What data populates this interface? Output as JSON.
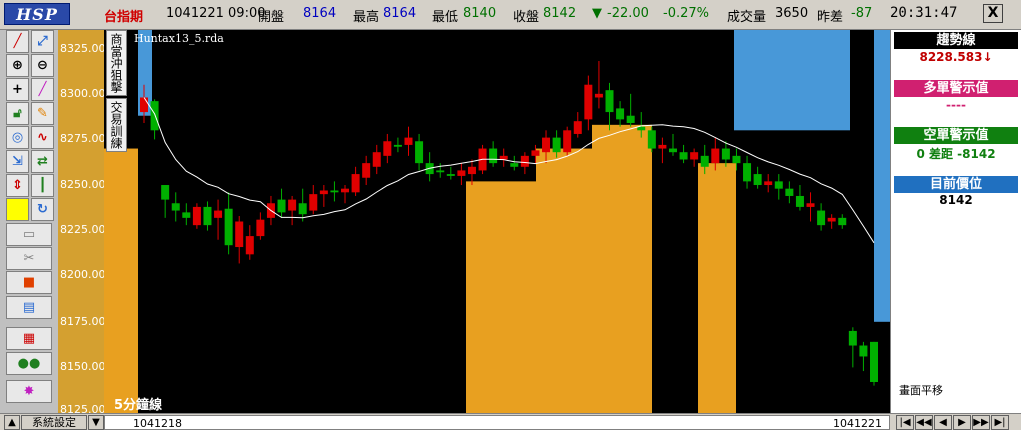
{
  "app": {
    "logo": "HSP",
    "instrument": "台指期",
    "date_time": "1041221  09:00",
    "open_label": "開盤",
    "open_value": "8164",
    "high_label": "最高",
    "high_value": "8164",
    "low_label": "最低",
    "low_value": "8140",
    "close_label": "收盤",
    "close_value": "8142",
    "change_arrow": "▼",
    "change_value": "-22.00",
    "change_pct": "-0.27%",
    "volume_label": "成交量",
    "volume_value": "3650",
    "diff_label": "昨差",
    "diff_value": "-87",
    "clock": "20:31:47",
    "close_button": "X"
  },
  "chart": {
    "file_label": "Huntax13_5.rda",
    "period_label": "5分鐘線",
    "side_tabs": [
      "商當沖狙擊",
      "交易訓練"
    ],
    "y_ticks": [
      "8325.00",
      "8300.00",
      "8275.00",
      "8250.00",
      "8225.00",
      "8200.00",
      "8175.00",
      "8150.00",
      "8125.00"
    ],
    "colors": {
      "up": "#e00000",
      "down": "#00b000",
      "fill_orange": "#e8a020",
      "fill_blue": "#4898d8",
      "ma": "#ffffff"
    }
  },
  "chart_data": {
    "type": "candlestick",
    "ylim": [
      8125,
      8335
    ],
    "candles": [
      {
        "o": 8290,
        "h": 8305,
        "l": 8284,
        "c": 8298
      },
      {
        "o": 8296,
        "h": 8297,
        "l": 8275,
        "c": 8280
      },
      {
        "o": 8250,
        "h": 8250,
        "l": 8232,
        "c": 8242
      },
      {
        "o": 8240,
        "h": 8246,
        "l": 8230,
        "c": 8236
      },
      {
        "o": 8235,
        "h": 8240,
        "l": 8228,
        "c": 8232
      },
      {
        "o": 8228,
        "h": 8240,
        "l": 8226,
        "c": 8238
      },
      {
        "o": 8238,
        "h": 8241,
        "l": 8225,
        "c": 8228
      },
      {
        "o": 8232,
        "h": 8242,
        "l": 8220,
        "c": 8236
      },
      {
        "o": 8237,
        "h": 8246,
        "l": 8212,
        "c": 8217
      },
      {
        "o": 8216,
        "h": 8233,
        "l": 8207,
        "c": 8230
      },
      {
        "o": 8212,
        "h": 8228,
        "l": 8209,
        "c": 8222
      },
      {
        "o": 8222,
        "h": 8235,
        "l": 8220,
        "c": 8231
      },
      {
        "o": 8232,
        "h": 8244,
        "l": 8228,
        "c": 8240
      },
      {
        "o": 8242,
        "h": 8248,
        "l": 8232,
        "c": 8235
      },
      {
        "o": 8236,
        "h": 8244,
        "l": 8228,
        "c": 8242
      },
      {
        "o": 8240,
        "h": 8248,
        "l": 8230,
        "c": 8234
      },
      {
        "o": 8236,
        "h": 8250,
        "l": 8234,
        "c": 8245
      },
      {
        "o": 8245,
        "h": 8250,
        "l": 8238,
        "c": 8247
      },
      {
        "o": 8247,
        "h": 8252,
        "l": 8241,
        "c": 8246
      },
      {
        "o": 8246,
        "h": 8250,
        "l": 8240,
        "c": 8248
      },
      {
        "o": 8246,
        "h": 8260,
        "l": 8244,
        "c": 8256
      },
      {
        "o": 8254,
        "h": 8266,
        "l": 8250,
        "c": 8262
      },
      {
        "o": 8260,
        "h": 8272,
        "l": 8256,
        "c": 8268
      },
      {
        "o": 8266,
        "h": 8278,
        "l": 8262,
        "c": 8274
      },
      {
        "o": 8272,
        "h": 8276,
        "l": 8268,
        "c": 8271
      },
      {
        "o": 8272,
        "h": 8282,
        "l": 8266,
        "c": 8276
      },
      {
        "o": 8274,
        "h": 8278,
        "l": 8258,
        "c": 8262
      },
      {
        "o": 8262,
        "h": 8268,
        "l": 8252,
        "c": 8256
      },
      {
        "o": 8258,
        "h": 8262,
        "l": 8254,
        "c": 8257
      },
      {
        "o": 8256,
        "h": 8260,
        "l": 8253,
        "c": 8255
      },
      {
        "o": 8255,
        "h": 8262,
        "l": 8250,
        "c": 8258
      },
      {
        "o": 8256,
        "h": 8264,
        "l": 8250,
        "c": 8260
      },
      {
        "o": 8258,
        "h": 8272,
        "l": 8256,
        "c": 8270
      },
      {
        "o": 8270,
        "h": 8274,
        "l": 8260,
        "c": 8262
      },
      {
        "o": 8264,
        "h": 8270,
        "l": 8260,
        "c": 8266
      },
      {
        "o": 8262,
        "h": 8266,
        "l": 8258,
        "c": 8260
      },
      {
        "o": 8260,
        "h": 8268,
        "l": 8256,
        "c": 8266
      },
      {
        "o": 8266,
        "h": 8272,
        "l": 8262,
        "c": 8269
      },
      {
        "o": 8268,
        "h": 8280,
        "l": 8262,
        "c": 8276
      },
      {
        "o": 8276,
        "h": 8280,
        "l": 8265,
        "c": 8268
      },
      {
        "o": 8268,
        "h": 8282,
        "l": 8266,
        "c": 8280
      },
      {
        "o": 8278,
        "h": 8290,
        "l": 8276,
        "c": 8285
      },
      {
        "o": 8286,
        "h": 8310,
        "l": 8280,
        "c": 8305
      },
      {
        "o": 8298,
        "h": 8318,
        "l": 8292,
        "c": 8300
      },
      {
        "o": 8302,
        "h": 8306,
        "l": 8280,
        "c": 8290
      },
      {
        "o": 8292,
        "h": 8296,
        "l": 8282,
        "c": 8286
      },
      {
        "o": 8288,
        "h": 8300,
        "l": 8282,
        "c": 8284
      },
      {
        "o": 8282,
        "h": 8290,
        "l": 8276,
        "c": 8280
      },
      {
        "o": 8280,
        "h": 8282,
        "l": 8268,
        "c": 8270
      },
      {
        "o": 8270,
        "h": 8276,
        "l": 8262,
        "c": 8272
      },
      {
        "o": 8270,
        "h": 8278,
        "l": 8266,
        "c": 8268
      },
      {
        "o": 8268,
        "h": 8272,
        "l": 8262,
        "c": 8264
      },
      {
        "o": 8264,
        "h": 8270,
        "l": 8260,
        "c": 8268
      },
      {
        "o": 8266,
        "h": 8272,
        "l": 8256,
        "c": 8260
      },
      {
        "o": 8262,
        "h": 8276,
        "l": 8258,
        "c": 8270
      },
      {
        "o": 8270,
        "h": 8274,
        "l": 8260,
        "c": 8264
      },
      {
        "o": 8266,
        "h": 8270,
        "l": 8258,
        "c": 8262
      },
      {
        "o": 8262,
        "h": 8266,
        "l": 8248,
        "c": 8252
      },
      {
        "o": 8256,
        "h": 8260,
        "l": 8248,
        "c": 8250
      },
      {
        "o": 8250,
        "h": 8256,
        "l": 8246,
        "c": 8252
      },
      {
        "o": 8252,
        "h": 8256,
        "l": 8242,
        "c": 8248
      },
      {
        "o": 8248,
        "h": 8252,
        "l": 8240,
        "c": 8244
      },
      {
        "o": 8244,
        "h": 8250,
        "l": 8236,
        "c": 8238
      },
      {
        "o": 8238,
        "h": 8246,
        "l": 8230,
        "c": 8240
      },
      {
        "o": 8236,
        "h": 8240,
        "l": 8225,
        "c": 8228
      },
      {
        "o": 8230,
        "h": 8234,
        "l": 8226,
        "c": 8232
      },
      {
        "o": 8232,
        "h": 8234,
        "l": 8226,
        "c": 8228
      },
      {
        "o": 8170,
        "h": 8172,
        "l": 8150,
        "c": 8162
      },
      {
        "o": 8162,
        "h": 8164,
        "l": 8148,
        "c": 8156
      },
      {
        "o": 8164,
        "h": 8164,
        "l": 8140,
        "c": 8142
      }
    ]
  },
  "right_panel": {
    "trend_label": "趨勢線",
    "trend_value": "8228.583↓",
    "long_label": "多單警示值",
    "long_value": "----",
    "short_label": "空單警示值",
    "short_value": "0   差距  -8142",
    "position_label": "目前價位",
    "position_value": "8142",
    "note": "畫面平移"
  },
  "bottom": {
    "up_btn": "▲",
    "system_label": "系統設定",
    "down_btn": "▼",
    "date_left": "1041218",
    "date_right": "1041221",
    "nav": [
      "|◀",
      "◀◀",
      "◀",
      "▶",
      "▶▶",
      "▶|"
    ]
  }
}
